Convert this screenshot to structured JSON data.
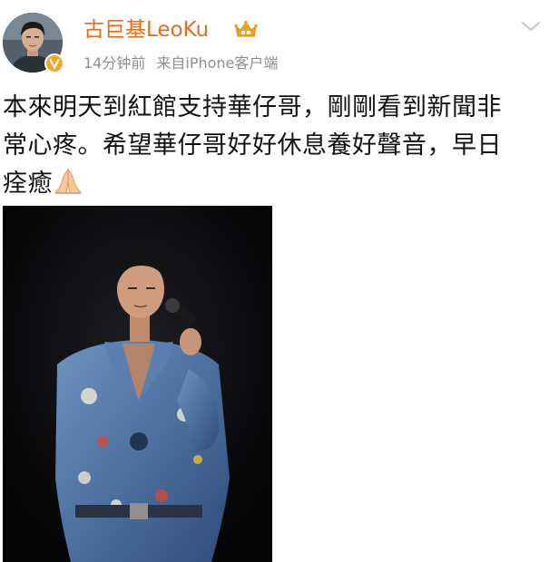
{
  "post": {
    "author": {
      "name": "古巨基LeoKu",
      "avatar_icon": "user-avatar",
      "verified_icon": "verified-v-badge",
      "member_icon": "crown-member-icon"
    },
    "meta": {
      "time": "14分钟前",
      "source": "来自iPhone客户端"
    },
    "menu_icon": "chevron-down-icon",
    "text_line_1": "本來明天到紅館支持華仔哥，剛剛看到新聞非",
    "text_line_2": "常心疼。希望華仔哥好好休息養好聲音，早日",
    "text_line_3": "痊癒",
    "emoji": "folded-hands",
    "photo": {
      "subject": "performer-on-stage-with-microphone"
    }
  },
  "colors": {
    "username": "#e86b1c",
    "meta": "#8e8e8e",
    "text": "#111111",
    "badge": "#f5a623",
    "photo_bg": "#0c0c0e"
  }
}
